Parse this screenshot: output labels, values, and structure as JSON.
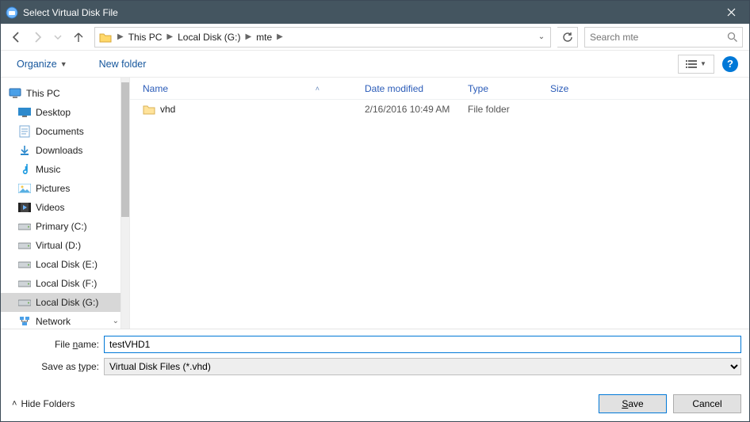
{
  "window": {
    "title": "Select Virtual Disk File"
  },
  "breadcrumbs": {
    "items": [
      "This PC",
      "Local Disk (G:)",
      "mte"
    ]
  },
  "search": {
    "placeholder": "Search mte"
  },
  "toolbar": {
    "organize": "Organize",
    "newfolder": "New folder"
  },
  "navtree": {
    "root": "This PC",
    "items": [
      {
        "label": "Desktop",
        "icon": "desktop"
      },
      {
        "label": "Documents",
        "icon": "doc"
      },
      {
        "label": "Downloads",
        "icon": "download"
      },
      {
        "label": "Music",
        "icon": "music"
      },
      {
        "label": "Pictures",
        "icon": "picture"
      },
      {
        "label": "Videos",
        "icon": "video"
      },
      {
        "label": "Primary (C:)",
        "icon": "drive"
      },
      {
        "label": "Virtual (D:)",
        "icon": "drive"
      },
      {
        "label": "Local Disk (E:)",
        "icon": "drive"
      },
      {
        "label": "Local Disk (F:)",
        "icon": "drive"
      },
      {
        "label": "Local Disk (G:)",
        "icon": "drive",
        "selected": true
      },
      {
        "label": "Network",
        "icon": "network"
      }
    ]
  },
  "columns": {
    "name": "Name",
    "date": "Date modified",
    "type": "Type",
    "size": "Size"
  },
  "files": [
    {
      "name": "vhd",
      "date": "2/16/2016 10:49 AM",
      "type": "File folder",
      "size": ""
    }
  ],
  "form": {
    "filename_label_pre": "File ",
    "filename_label_u": "n",
    "filename_label_post": "ame:",
    "filename_value": "testVHD1",
    "saveastype_label_pre": "Save as ",
    "saveastype_label_u": "t",
    "saveastype_label_post": "ype:",
    "saveastype_value": "Virtual Disk Files (*.vhd)"
  },
  "footer": {
    "hide_folders": "Hide Folders",
    "save_u": "S",
    "save_post": "ave",
    "cancel": "Cancel"
  }
}
